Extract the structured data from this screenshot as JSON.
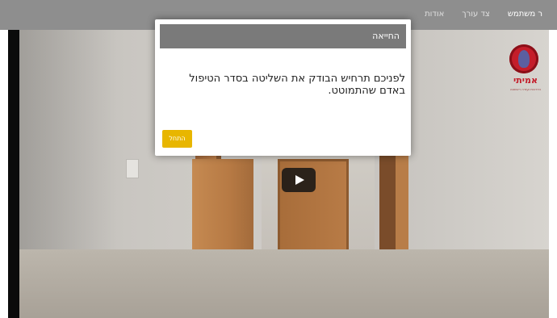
{
  "nav": {
    "items": [
      {
        "label": "ר משתמש",
        "active": true
      },
      {
        "label": "צד עורך",
        "active": false
      },
      {
        "label": "אודות",
        "active": false
      }
    ]
  },
  "logo": {
    "name": "אמיתי",
    "tagline": "הדרכות ועזרה ראשונה"
  },
  "video": {
    "play_icon": "play-icon"
  },
  "modal": {
    "title": "החייאה",
    "body": "לפניכם תרחיש הבודק את השליטה בסדר הטיפול באדם שהתמוטט.",
    "start_label": "התחל",
    "accent": "#e8b600"
  }
}
